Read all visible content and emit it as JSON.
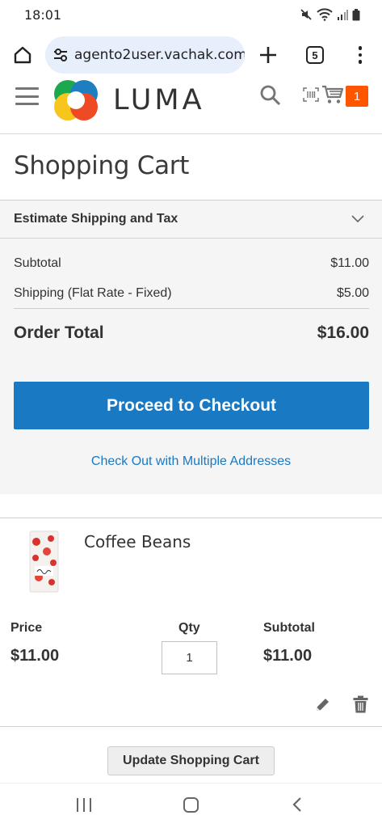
{
  "status_bar": {
    "time": "18:01"
  },
  "browser": {
    "url": "agento2user.vachak.com",
    "tab_count": "5"
  },
  "header": {
    "logo_text": "LUMA",
    "cart_count": "1",
    "brand_colors": {
      "accent": "#ff5501",
      "primary_blue": "#1979c3"
    }
  },
  "page": {
    "title": "Shopping Cart"
  },
  "summary": {
    "estimate_label": "Estimate Shipping and Tax",
    "subtotal_label": "Subtotal",
    "subtotal_value": "$11.00",
    "shipping_label": "Shipping (Flat Rate - Fixed)",
    "shipping_value": "$5.00",
    "order_total_label": "Order Total",
    "order_total_value": "$16.00",
    "checkout_button": "Proceed to Checkout",
    "multi_address_link": "Check Out with Multiple Addresses"
  },
  "item": {
    "name": "Coffee Beans",
    "price_label": "Price",
    "price_value": "$11.00",
    "qty_label": "Qty",
    "qty_value": "1",
    "subtotal_label": "Subtotal",
    "subtotal_value": "$11.00"
  },
  "actions": {
    "update_cart_button": "Update Shopping Cart"
  },
  "icons": {
    "home": "home-icon",
    "site_settings": "tune-icon",
    "new_tab": "plus-icon",
    "more": "more-vert-icon",
    "menu": "hamburger-icon",
    "search": "search-icon",
    "cart": "cart-icon",
    "edit": "pencil-icon",
    "delete": "trash-icon"
  }
}
